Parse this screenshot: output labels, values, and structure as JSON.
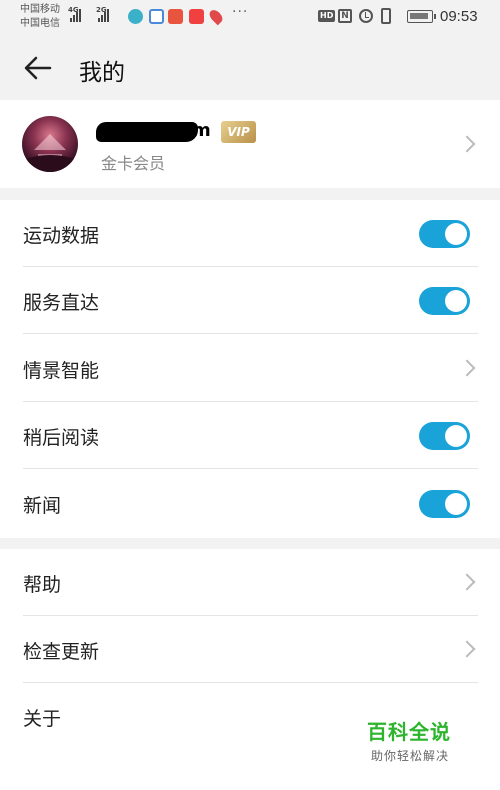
{
  "status_bar": {
    "carrier_1": "中国移动",
    "carrier_2": "中国电信",
    "network_1": "4G",
    "network_2": "2G",
    "more": "···",
    "hd_badge": "HD",
    "nfc": "N",
    "time": "09:53",
    "app_icons": [
      "browser-app-icon",
      "weather-app-icon",
      "game-app-icon",
      "shop-app-icon",
      "location-app-icon"
    ]
  },
  "nav": {
    "title": "我的"
  },
  "profile": {
    "username": "m",
    "vip_label": "VIP",
    "member_level": "金卡会员"
  },
  "settings": {
    "group1": [
      {
        "label": "运动数据",
        "type": "toggle",
        "on": true
      },
      {
        "label": "服务直达",
        "type": "toggle",
        "on": true
      },
      {
        "label": "情景智能",
        "type": "link"
      },
      {
        "label": "稍后阅读",
        "type": "toggle",
        "on": true
      },
      {
        "label": "新闻",
        "type": "toggle",
        "on": true
      }
    ],
    "group2": [
      {
        "label": "帮助",
        "type": "link"
      },
      {
        "label": "检查更新",
        "type": "link"
      },
      {
        "label": "关于",
        "type": "link"
      }
    ]
  },
  "watermark": {
    "title": "百科全说",
    "subtitle": "助你轻松解决"
  },
  "colors": {
    "toggle_on": "#1aa3d8",
    "vip_gold": "#c9a45e",
    "watermark_green": "#2cb52c"
  }
}
